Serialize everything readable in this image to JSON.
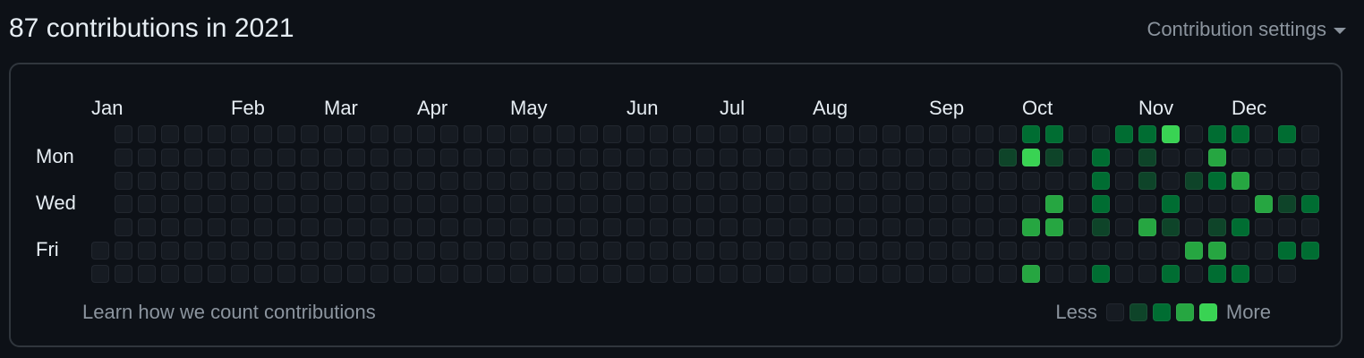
{
  "header": {
    "title": "87 contributions in 2021",
    "settings_label": "Contribution settings"
  },
  "months": [
    "Jan",
    "Feb",
    "Mar",
    "Apr",
    "May",
    "Jun",
    "Jul",
    "Aug",
    "Sep",
    "Oct",
    "Nov",
    "Dec"
  ],
  "days": [
    "Mon",
    "Wed",
    "Fri"
  ],
  "footer": {
    "learn_link": "Learn how we count contributions",
    "less_label": "Less",
    "more_label": "More"
  },
  "colors": {
    "level0": "#161b22",
    "level1": "#0e4429",
    "level2": "#006d32",
    "level3": "#26a641",
    "level4": "#39d353",
    "active_cells": [
      [
        40,
        0,
        2
      ],
      [
        41,
        0,
        2
      ],
      [
        44,
        0,
        2
      ],
      [
        45,
        0,
        2
      ],
      [
        46,
        0,
        4
      ],
      [
        48,
        0,
        2
      ],
      [
        49,
        0,
        2
      ],
      [
        51,
        0,
        2
      ],
      [
        39,
        1,
        1
      ],
      [
        40,
        1,
        4
      ],
      [
        41,
        1,
        1
      ],
      [
        43,
        1,
        2
      ],
      [
        45,
        1,
        1
      ],
      [
        48,
        1,
        3
      ],
      [
        43,
        2,
        2
      ],
      [
        45,
        2,
        1
      ],
      [
        47,
        2,
        1
      ],
      [
        48,
        2,
        2
      ],
      [
        49,
        2,
        3
      ],
      [
        41,
        3,
        3
      ],
      [
        43,
        3,
        2
      ],
      [
        46,
        3,
        2
      ],
      [
        50,
        3,
        3
      ],
      [
        51,
        3,
        1
      ],
      [
        52,
        3,
        2
      ],
      [
        40,
        4,
        3
      ],
      [
        41,
        4,
        3
      ],
      [
        43,
        4,
        1
      ],
      [
        45,
        4,
        3
      ],
      [
        46,
        4,
        1
      ],
      [
        48,
        4,
        1
      ],
      [
        49,
        4,
        2
      ],
      [
        47,
        5,
        3
      ],
      [
        48,
        5,
        3
      ],
      [
        51,
        5,
        2
      ],
      [
        52,
        5,
        2
      ],
      [
        40,
        6,
        3
      ],
      [
        43,
        6,
        2
      ],
      [
        46,
        6,
        2
      ],
      [
        48,
        6,
        2
      ],
      [
        49,
        6,
        2
      ]
    ]
  }
}
